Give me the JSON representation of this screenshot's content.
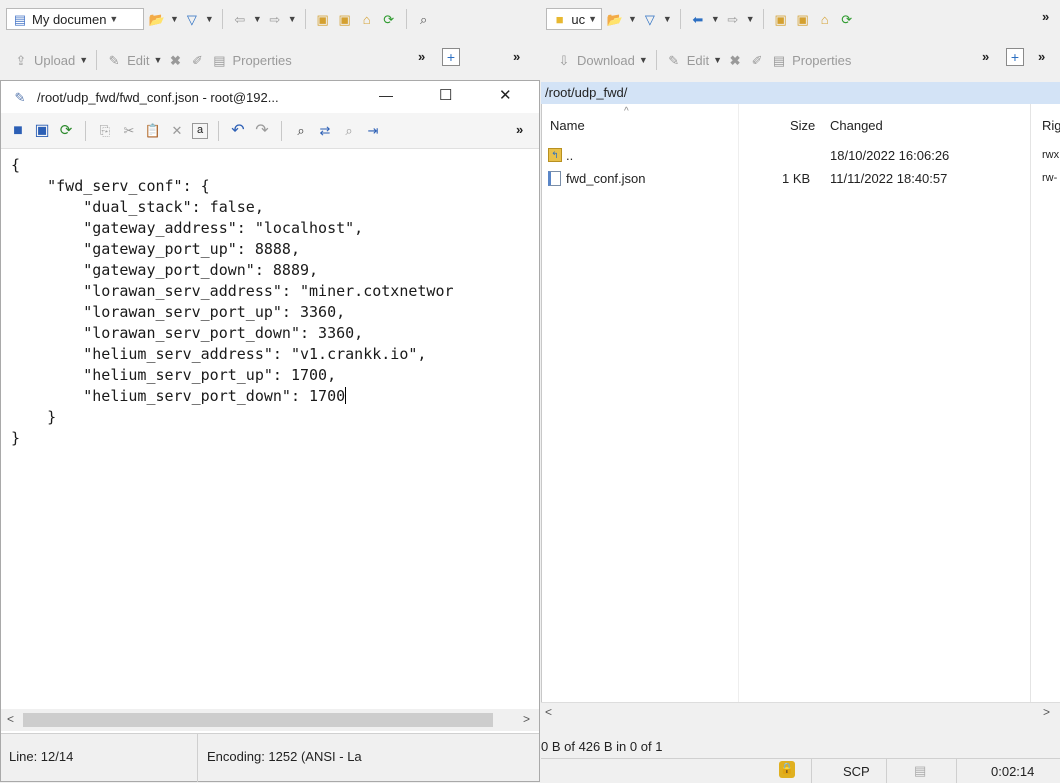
{
  "left_toolbar": {
    "location": "My documen",
    "upload": "Upload",
    "edit": "Edit",
    "properties": "Properties",
    "more": "»"
  },
  "right_toolbar": {
    "location": "uc",
    "download": "Download",
    "edit": "Edit",
    "properties": "Properties",
    "more": "»"
  },
  "editor": {
    "title": "/root/udp_fwd/fwd_conf.json - root@192...",
    "minimize": "—",
    "maximize": "☐",
    "close": "✕",
    "lines": [
      "{",
      "    \"fwd_serv_conf\": {",
      "        \"dual_stack\": false,",
      "        \"gateway_address\": \"localhost\",",
      "        \"gateway_port_up\": 8888,",
      "        \"gateway_port_down\": 8889,",
      "        \"lorawan_serv_address\": \"miner.cotxnetwor",
      "        \"lorawan_serv_port_up\": 3360,",
      "        \"lorawan_serv_port_down\": 3360,",
      "        \"helium_serv_address\": \"v1.crankk.io\",",
      "        \"helium_serv_port_up\": 1700,",
      "        \"helium_serv_port_down\": 1700",
      "    }",
      "}"
    ],
    "status_line": "Line: 12/14",
    "status_encoding": "Encoding: 1252  (ANSI - La"
  },
  "remote": {
    "path": "/root/udp_fwd/",
    "columns": {
      "name": "Name",
      "size": "Size",
      "changed": "Changed",
      "rights": "Rig"
    },
    "rows": [
      {
        "name": "..",
        "size": "",
        "changed": "18/10/2022 16:06:26",
        "rights": "rwx"
      },
      {
        "name": "fwd_conf.json",
        "size": "1 KB",
        "changed": "11/11/2022 18:40:57",
        "rights": "rw-"
      }
    ],
    "selection_status": "0 B of 426 B in 0 of 1"
  },
  "statusbar": {
    "protocol": "SCP",
    "time": "0:02:14"
  },
  "colors": {
    "path_bar": "#d3e3f6",
    "accent": "#1f5fbf",
    "lock": "#e0b020"
  }
}
